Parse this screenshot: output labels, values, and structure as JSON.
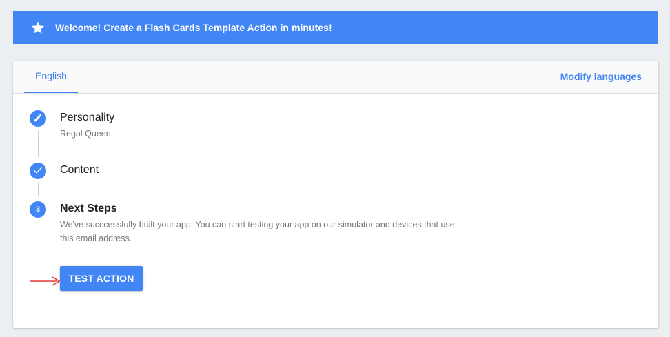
{
  "banner": {
    "icon": "star-icon",
    "text": "Welcome! Create a Flash Cards Template Action in minutes!",
    "color": "#4285f4"
  },
  "tabs": {
    "active": "English",
    "modify_label": "Modify languages"
  },
  "steps": [
    {
      "icon": "pencil-icon",
      "title": "Personality",
      "subtitle": "Regal Queen"
    },
    {
      "icon": "check-icon",
      "title": "Content",
      "subtitle": ""
    },
    {
      "number": "3",
      "title": "Next Steps",
      "subtitle": "We've succcessfully built your app. You can start testing your app on our simulator and devices that use this email address."
    }
  ],
  "test_button": {
    "label": "TEST ACTION"
  },
  "annotation": {
    "icon": "red-arrow-icon",
    "color": "#e53935"
  }
}
